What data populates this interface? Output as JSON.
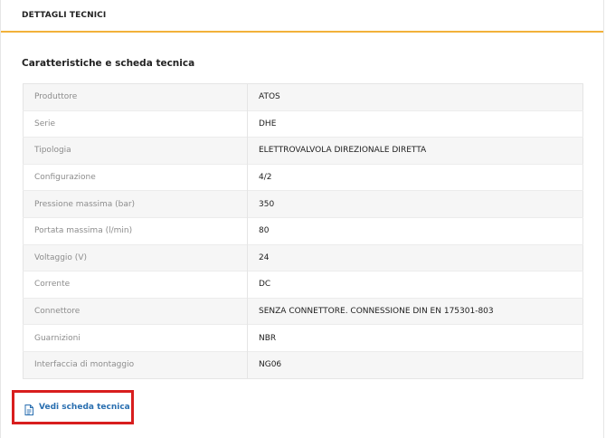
{
  "header": {
    "title": "DETTAGLI TECNICI"
  },
  "section": {
    "title": "Caratteristiche e scheda tecnica"
  },
  "specs": [
    {
      "label": "Produttore",
      "value": "ATOS"
    },
    {
      "label": "Serie",
      "value": "DHE"
    },
    {
      "label": "Tipologia",
      "value": "ELETTROVALVOLA DIREZIONALE DIRETTA"
    },
    {
      "label": "Configurazione",
      "value": "4/2"
    },
    {
      "label": "Pressione massima (bar)",
      "value": "350"
    },
    {
      "label": "Portata massima (l/min)",
      "value": "80"
    },
    {
      "label": "Voltaggio (V)",
      "value": "24"
    },
    {
      "label": "Corrente",
      "value": "DC"
    },
    {
      "label": "Connettore",
      "value": "SENZA CONNETTORE. CONNESSIONE DIN EN 175301-803"
    },
    {
      "label": "Guarnizioni",
      "value": "NBR"
    },
    {
      "label": "Interfaccia di montaggio",
      "value": "NG06"
    }
  ],
  "datasheet_link": {
    "label": "Vedi scheda tecnica",
    "icon": "document-icon"
  },
  "colors": {
    "accent": "#f2b13a",
    "link": "#2a6fb0",
    "highlight": "#d81e1e"
  }
}
